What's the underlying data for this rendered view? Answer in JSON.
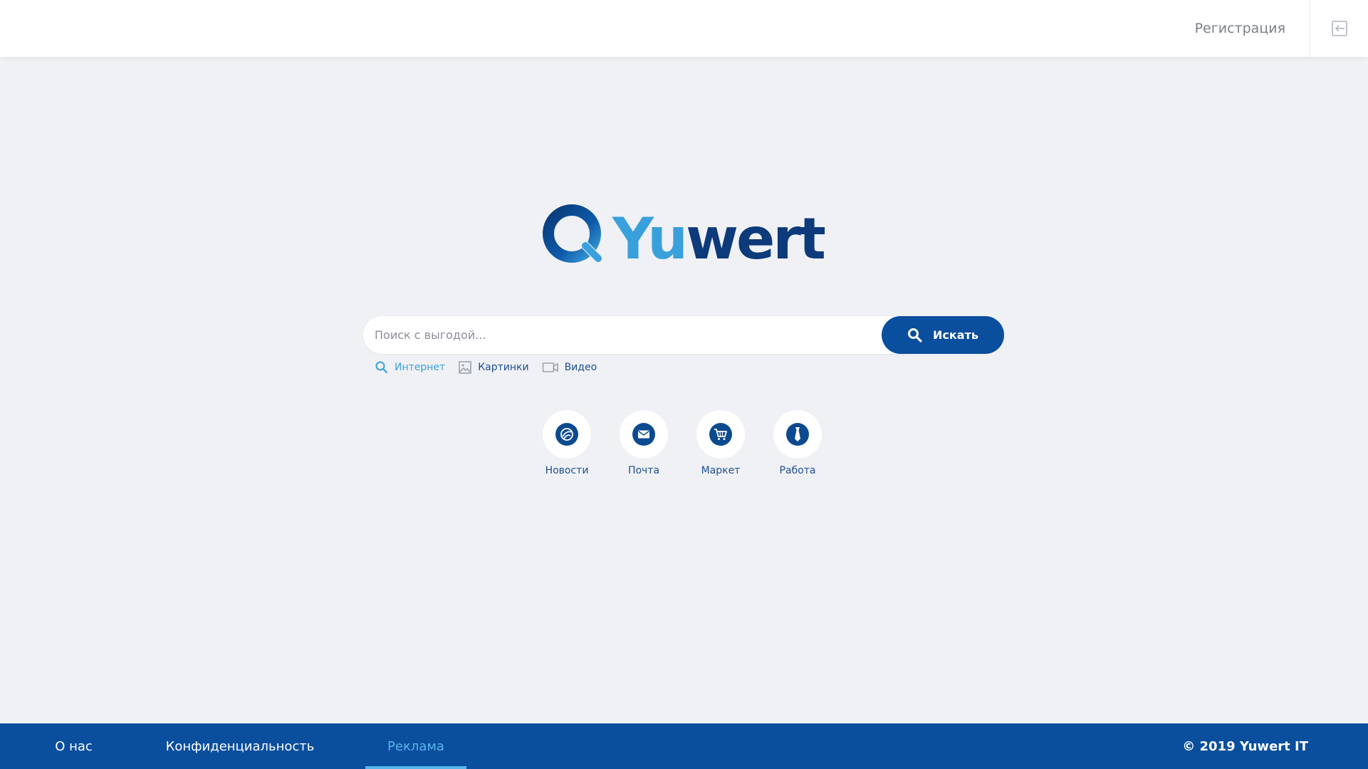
{
  "header": {
    "register_label": "Регистрация",
    "login_icon": "login-arrow-icon"
  },
  "logo": {
    "text_part1": "Yu",
    "text_part2": "wert",
    "colors": {
      "light": "#3aa0dc",
      "dark": "#0c3a7a"
    }
  },
  "search": {
    "placeholder": "Поиск с выгодой...",
    "value": "",
    "button_label": "Искать",
    "button_icon": "search-icon",
    "tabs": [
      {
        "label": "Интернет",
        "icon": "search-icon",
        "active": true
      },
      {
        "label": "Картинки",
        "icon": "image-icon",
        "active": false
      },
      {
        "label": "Видео",
        "icon": "video-icon",
        "active": false
      }
    ]
  },
  "services": [
    {
      "label": "Новости",
      "icon": "news-icon"
    },
    {
      "label": "Почта",
      "icon": "mail-icon"
    },
    {
      "label": "Маркет",
      "icon": "cart-icon"
    },
    {
      "label": "Работа",
      "icon": "tie-icon"
    }
  ],
  "footer": {
    "links": [
      {
        "label": "О нас",
        "active": false
      },
      {
        "label": "Конфиденциальность",
        "active": false
      },
      {
        "label": "Реклама",
        "active": true
      }
    ],
    "copyright": "© 2019 Yuwert IT"
  },
  "colors": {
    "brand_dark": "#0a4e9e",
    "brand_light": "#3aa0dc",
    "background": "#f0f1f5",
    "active_link": "#56b5ea"
  }
}
